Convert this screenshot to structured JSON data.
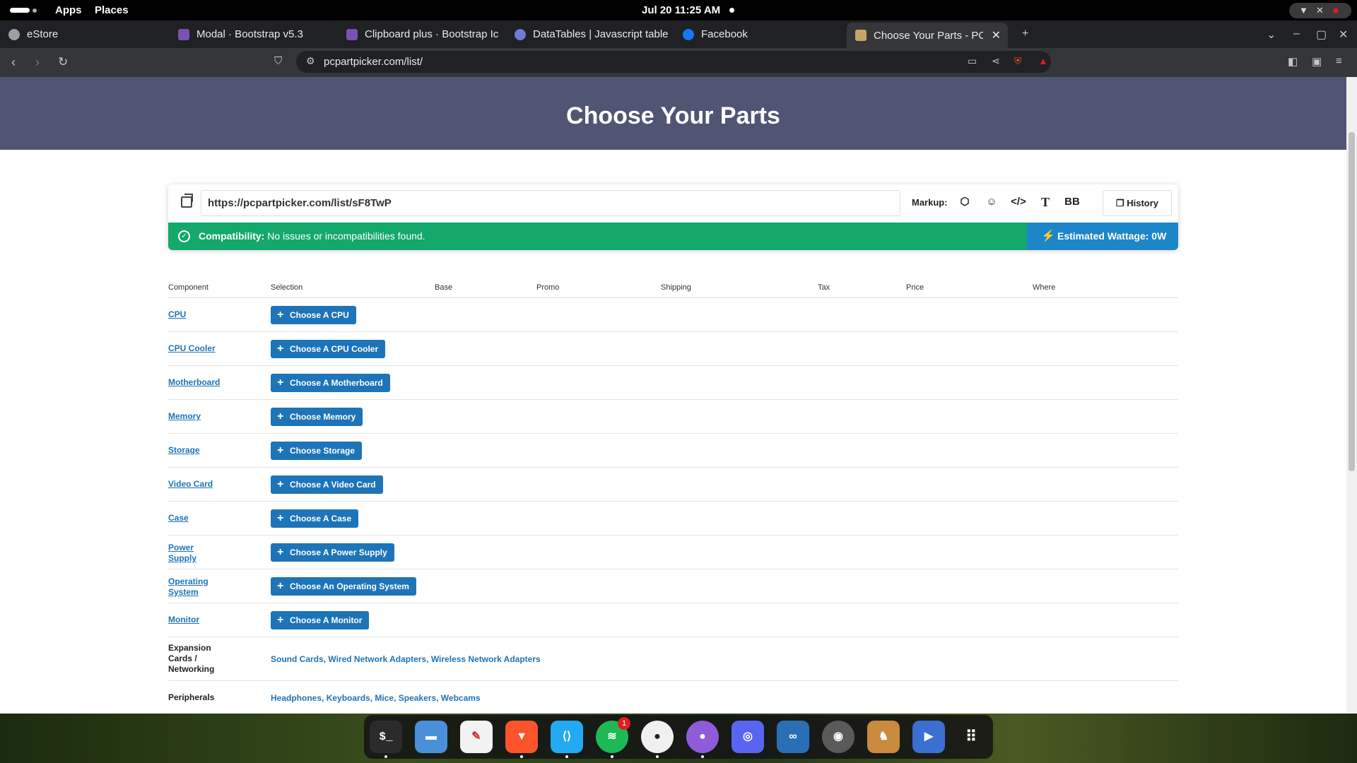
{
  "system": {
    "menus": [
      "Apps",
      "Places"
    ],
    "clock": "Jul 20  11:25 AM"
  },
  "browser": {
    "tabs": [
      {
        "title": "eStore",
        "favicon_color": "#9aa0a6"
      },
      {
        "title": "Modal · Bootstrap v5.3",
        "favicon_color": "#7952b3"
      },
      {
        "title": "Clipboard plus · Bootstrap Ic",
        "favicon_color": "#7952b3"
      },
      {
        "title": "DataTables | Javascript table",
        "favicon_color": "#6f7bd6"
      },
      {
        "title": "Facebook",
        "favicon_color": "#1877f2"
      },
      {
        "title": "Choose Your Parts - PCPa",
        "favicon_color": "#c7a56a",
        "active": true
      }
    ],
    "url": "pcpartpicker.com/list/"
  },
  "page": {
    "title": "Choose Your Parts",
    "permalink": "https://pcpartpicker.com/list/sF8TwP",
    "markup_label": "Markup:",
    "history_label": "History",
    "compat_label": "Compatibility:",
    "compat_text": "No issues or incompatibilities found.",
    "wattage": "Estimated Wattage: 0W",
    "columns": [
      "Component",
      "Selection",
      "Base",
      "Promo",
      "Shipping",
      "Tax",
      "Price",
      "Where"
    ],
    "parts": [
      {
        "component": "CPU",
        "button": "Choose A CPU"
      },
      {
        "component": "CPU Cooler",
        "button": "Choose A CPU Cooler"
      },
      {
        "component": "Motherboard",
        "button": "Choose A Motherboard"
      },
      {
        "component": "Memory",
        "button": "Choose Memory"
      },
      {
        "component": "Storage",
        "button": "Choose Storage"
      },
      {
        "component": "Video Card",
        "button": "Choose A Video Card"
      },
      {
        "component": "Case",
        "button": "Choose A Case"
      },
      {
        "component": "Power Supply",
        "button": "Choose A Power Supply"
      },
      {
        "component": "Operating System",
        "button": "Choose An Operating System"
      },
      {
        "component": "Monitor",
        "button": "Choose A Monitor"
      }
    ],
    "expansion": {
      "label": "Expansion Cards / Networking",
      "links": [
        "Sound Cards",
        "Wired Network Adapters",
        "Wireless Network Adapters"
      ]
    },
    "peripherals": {
      "label": "Peripherals",
      "links": [
        "Headphones",
        "Keyboards",
        "Mice",
        "Speakers",
        "Webcams"
      ]
    }
  },
  "dock": {
    "apps": [
      {
        "name": "terminal-icon",
        "glyph": "$_",
        "color": "#2b2b2b"
      },
      {
        "name": "files-icon",
        "glyph": "▬",
        "color": "#4a90d9"
      },
      {
        "name": "text-editor-icon",
        "glyph": "✎",
        "color": "#f2f2f2"
      },
      {
        "name": "brave-icon",
        "glyph": "▼",
        "color": "#fb542b"
      },
      {
        "name": "vscode-icon",
        "glyph": "⟨⟩",
        "color": "#23a9f2"
      },
      {
        "name": "spotify-icon",
        "glyph": "≋",
        "color": "#1db954"
      },
      {
        "name": "github-icon",
        "glyph": "●",
        "color": "#f0f0f0"
      },
      {
        "name": "github-desktop-icon",
        "glyph": "●",
        "color": "#8e5cd9"
      },
      {
        "name": "discord-icon",
        "glyph": "◎",
        "color": "#5865f2"
      },
      {
        "name": "steam-icon",
        "glyph": "∞",
        "color": "#2a6fb5"
      },
      {
        "name": "obs-icon",
        "glyph": "◉",
        "color": "#5a5a5a"
      },
      {
        "name": "game-icon",
        "glyph": "♞",
        "color": "#c98a3e"
      },
      {
        "name": "remote-icon",
        "glyph": "▶",
        "color": "#3b6fd1"
      },
      {
        "name": "app-grid-icon",
        "glyph": "⋮⋮⋮",
        "color": "transparent"
      }
    ],
    "spotify_badge": "1"
  }
}
